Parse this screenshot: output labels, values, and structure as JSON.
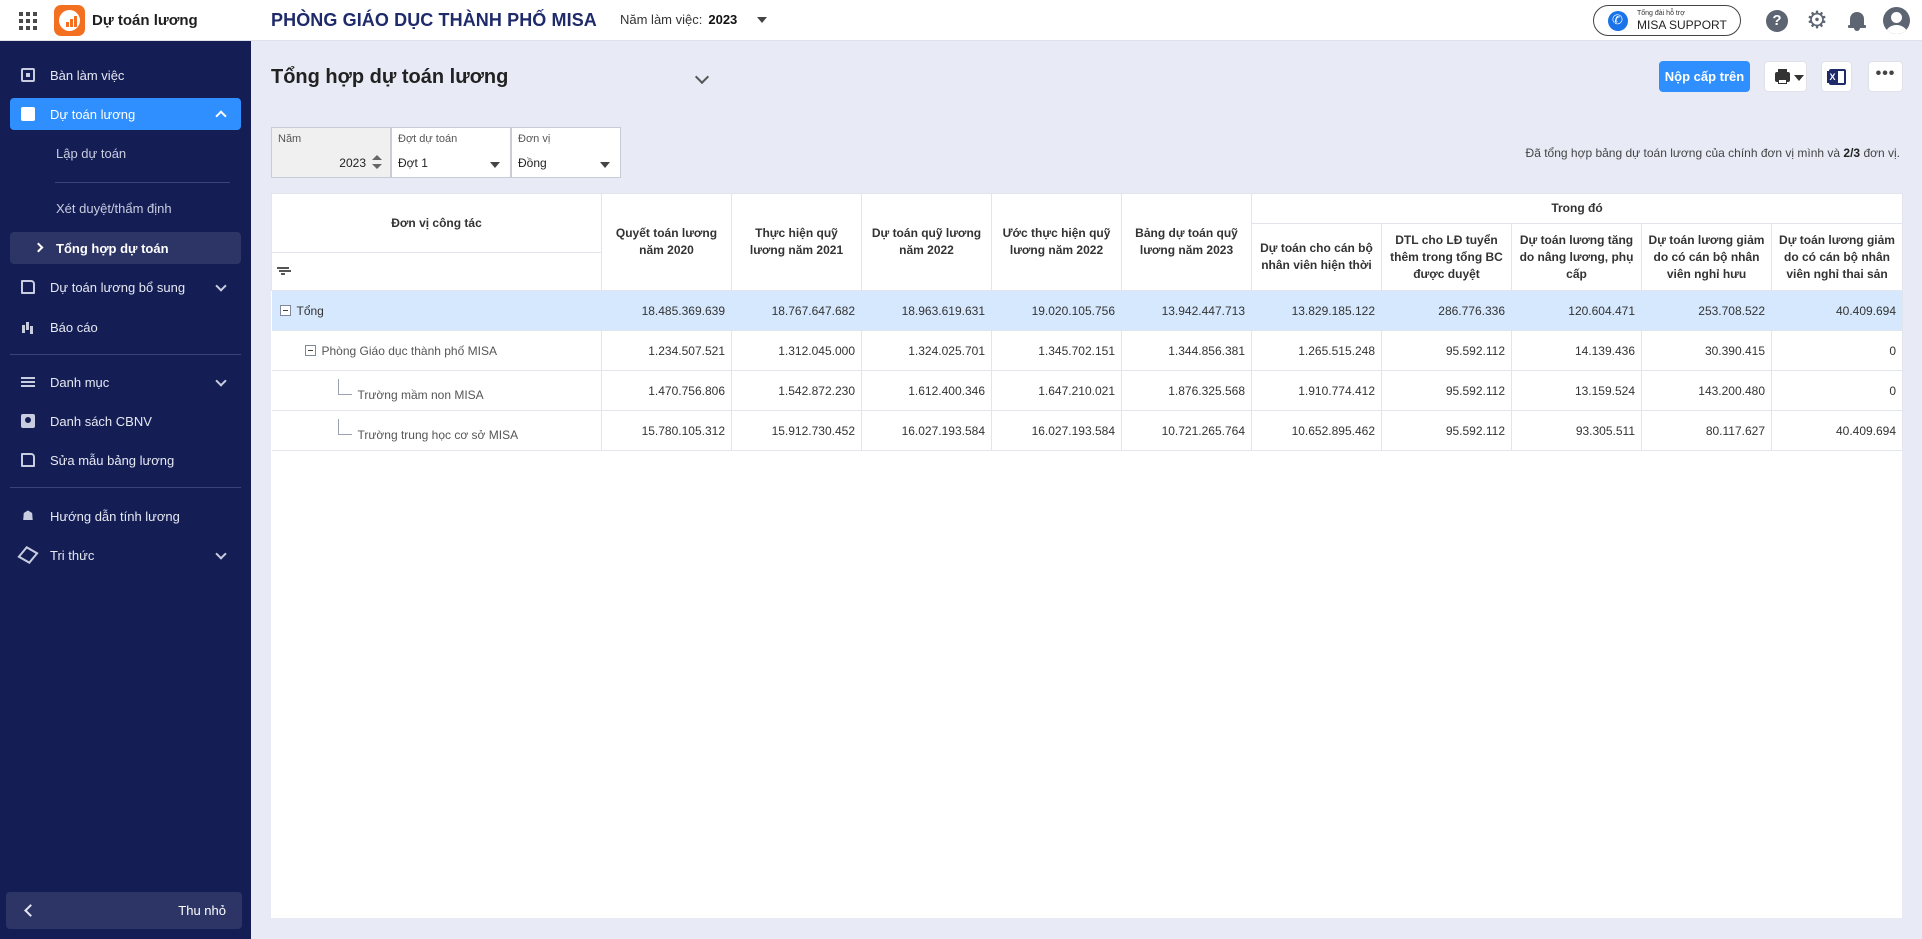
{
  "header": {
    "app_title": "Dự toán lương",
    "org_title": "PHÒNG GIÁO DỤC THÀNH PHỐ MISA",
    "work_year_label": "Năm làm việc:",
    "work_year_value": "2023",
    "support_small": "Tổng đài hỗ trợ",
    "support_label": "MISA SUPPORT",
    "help_icon": "help-icon",
    "settings_icon": "gear-icon",
    "notification_icon": "bell-icon",
    "accent_color": "#2f8fff",
    "brand_color": "#f37021"
  },
  "sidebar": {
    "bg_color": "#141e55",
    "items": [
      {
        "label": "Bàn làm việc",
        "icon": "dashboard-icon"
      },
      {
        "label": "Dự toán lương",
        "icon": "search-doc-icon"
      },
      {
        "label": "Lập dự toán"
      },
      {
        "label": "Xét duyệt/thẩm định"
      },
      {
        "label": "Tổng hợp dự toán"
      },
      {
        "label": "Dự toán lương bổ sung",
        "icon": "add-doc-icon"
      },
      {
        "label": "Báo cáo",
        "icon": "chart-icon"
      },
      {
        "label": "Danh mục",
        "icon": "list-icon"
      },
      {
        "label": "Danh sách CBNV",
        "icon": "people-icon"
      },
      {
        "label": "Sửa mẫu bảng lương",
        "icon": "edit-doc-icon"
      },
      {
        "label": "Hướng dẫn tính lương",
        "icon": "guide-icon"
      },
      {
        "label": "Tri thức",
        "icon": "cube-icon"
      }
    ],
    "collapse_label": "Thu nhỏ"
  },
  "main": {
    "title": "Tổng hợp dự toán lương",
    "submit_button": "Nộp cấp trên",
    "excel_glyph": "X",
    "more_glyph": "•••",
    "filters": {
      "year_label": "Năm",
      "year_value": "2023",
      "round_label": "Đợt dự toán",
      "round_value": "Đợt 1",
      "unit_label": "Đơn vị",
      "unit_value": "Đồng"
    },
    "summary_prefix": "Đã tổng hợp bảng dự toán lương của chính đơn vị mình và ",
    "summary_count": "2/3",
    "summary_suffix": " đơn vị."
  },
  "table": {
    "header_unit": "Đơn vị công tác",
    "header_group": "Trong đó",
    "columns": [
      "Quyết toán lương năm 2020",
      "Thực hiện quỹ lương năm 2021",
      "Dự toán quỹ lương năm 2022",
      "Ước thực hiện quỹ lương năm 2022",
      "Bảng dự toán quỹ lương năm 2023",
      "Dự toán cho cán bộ nhân viên hiện thời",
      "DTL cho LĐ tuyển thêm trong tổng BC được duyệt",
      "Dự toán lương tăng do nâng lương, phụ cấp",
      "Dự toán lương giảm do có cán bộ nhân viên nghỉ hưu",
      "Dự toán lương giảm do có cán bộ nhân viên nghỉ thai sản"
    ],
    "rows": [
      {
        "name": "Tổng",
        "values": [
          "18.485.369.639",
          "18.767.647.682",
          "18.963.619.631",
          "19.020.105.756",
          "13.942.447.713",
          "13.829.185.122",
          "286.776.336",
          "120.604.471",
          "253.708.522",
          "40.409.694"
        ]
      },
      {
        "name": "Phòng Giáo dục thành phố MISA",
        "values": [
          "1.234.507.521",
          "1.312.045.000",
          "1.324.025.701",
          "1.345.702.151",
          "1.344.856.381",
          "1.265.515.248",
          "95.592.112",
          "14.139.436",
          "30.390.415",
          "0"
        ]
      },
      {
        "name": "Trường mầm non MISA",
        "values": [
          "1.470.756.806",
          "1.542.872.230",
          "1.612.400.346",
          "1.647.210.021",
          "1.876.325.568",
          "1.910.774.412",
          "95.592.112",
          "13.159.524",
          "143.200.480",
          "0"
        ]
      },
      {
        "name": "Trường trung học cơ sở MISA",
        "values": [
          "15.780.105.312",
          "15.912.730.452",
          "16.027.193.584",
          "16.027.193.584",
          "10.721.265.764",
          "10.652.895.462",
          "95.592.112",
          "93.305.511",
          "80.117.627",
          "40.409.694"
        ]
      }
    ],
    "total_row_color": "#d6e8fd"
  }
}
